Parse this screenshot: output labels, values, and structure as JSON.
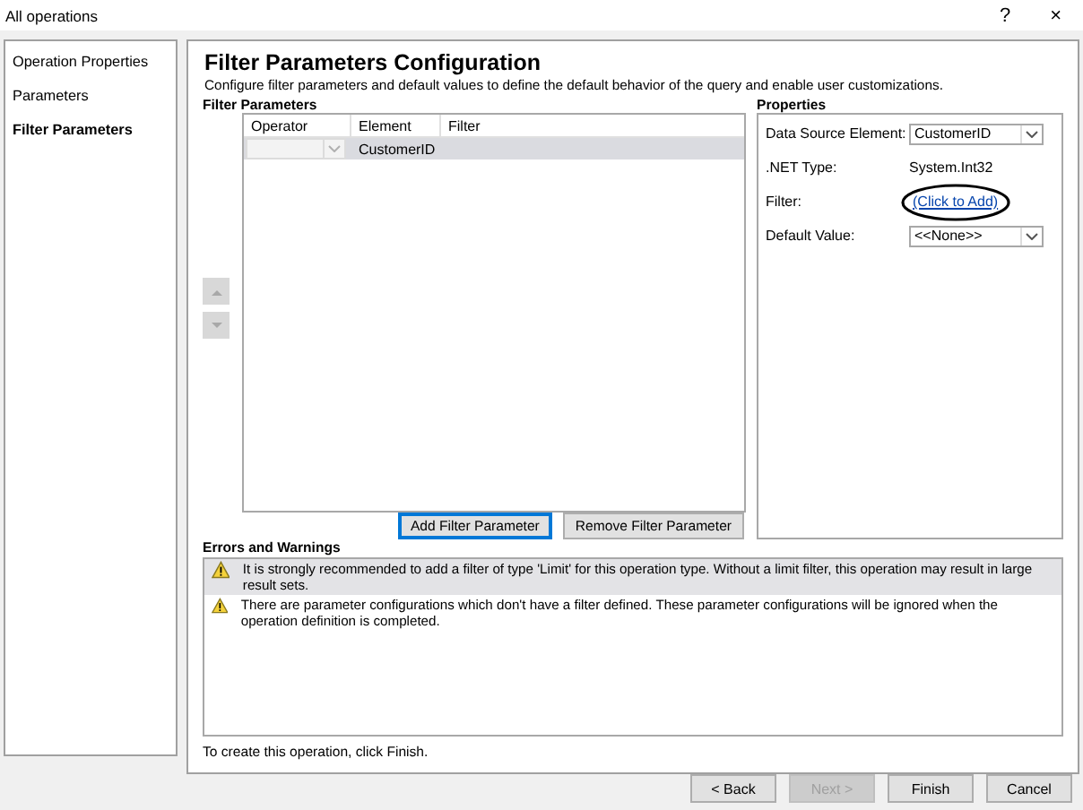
{
  "window": {
    "title": "All operations",
    "help": "?",
    "close": "×"
  },
  "nav": {
    "items": [
      {
        "label": "Operation Properties",
        "selected": false
      },
      {
        "label": "Parameters",
        "selected": false
      },
      {
        "label": "Filter Parameters",
        "selected": true
      }
    ]
  },
  "page": {
    "heading": "Filter Parameters Configuration",
    "description": "Configure filter parameters and default values to define the default behavior of the query and enable user customizations."
  },
  "filter_parameters": {
    "label": "Filter Parameters",
    "columns": [
      "Operator",
      "Element",
      "Filter"
    ],
    "rows": [
      {
        "element": "CustomerID",
        "selected": true
      }
    ],
    "move_up": {
      "disabled": true
    },
    "move_down": {
      "disabled": true
    },
    "buttons": [
      {
        "label": "Add Filter Parameter",
        "focused": true
      },
      {
        "label": "Remove Filter Parameter",
        "focused": false
      }
    ]
  },
  "properties": {
    "label": "Properties",
    "fields": [
      {
        "kind": "dropdown",
        "label": "Data Source Element:",
        "value": "CustomerID"
      },
      {
        "kind": "text",
        "label": ".NET Type:",
        "value": "System.Int32"
      },
      {
        "kind": "link",
        "label": "Filter:",
        "value": "(Click to Add)",
        "circled": true
      },
      {
        "kind": "dropdown",
        "label": "Default Value:",
        "value": "<<None>>"
      }
    ]
  },
  "errors": {
    "label": "Errors and Warnings",
    "items": [
      {
        "text": "It is strongly recommended to add a filter of type 'Limit' for this operation type. Without a limit filter, this operation may result in large result sets.",
        "selected": true
      },
      {
        "text": "There are parameter configurations which don't have a filter defined. These parameter configurations will be ignored when the operation definition is completed.",
        "selected": false
      }
    ]
  },
  "footer": "To create this operation, click Finish.",
  "buttons": [
    {
      "label": "< Back",
      "disabled": false
    },
    {
      "label": "Next >",
      "disabled": true
    },
    {
      "label": "Finish",
      "disabled": false
    },
    {
      "label": "Cancel",
      "disabled": false
    }
  ]
}
